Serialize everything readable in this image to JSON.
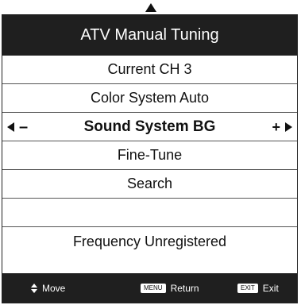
{
  "title": "ATV Manual Tuning",
  "items": [
    {
      "label": "Current CH 3"
    },
    {
      "label": "Color System Auto"
    },
    {
      "label": "Sound System BG",
      "selected": true
    },
    {
      "label": "Fine-Tune"
    },
    {
      "label": "Search"
    },
    {
      "label": ""
    },
    {
      "label": "Frequency Unregistered"
    }
  ],
  "selected_controls": {
    "left": "–",
    "right": "+"
  },
  "footer": {
    "move_label": "Move",
    "menu_key": "MENU",
    "return_label": "Return",
    "exit_key": "EXIT",
    "exit_label": "Exit"
  },
  "icons": {
    "scroll_up": "up-arrow-icon",
    "left": "left-arrow-icon",
    "right": "right-arrow-icon",
    "updown": "up-down-icon"
  },
  "colors": {
    "bar": "#1f1f1f",
    "background": "#ffffff",
    "text": "#111111"
  }
}
